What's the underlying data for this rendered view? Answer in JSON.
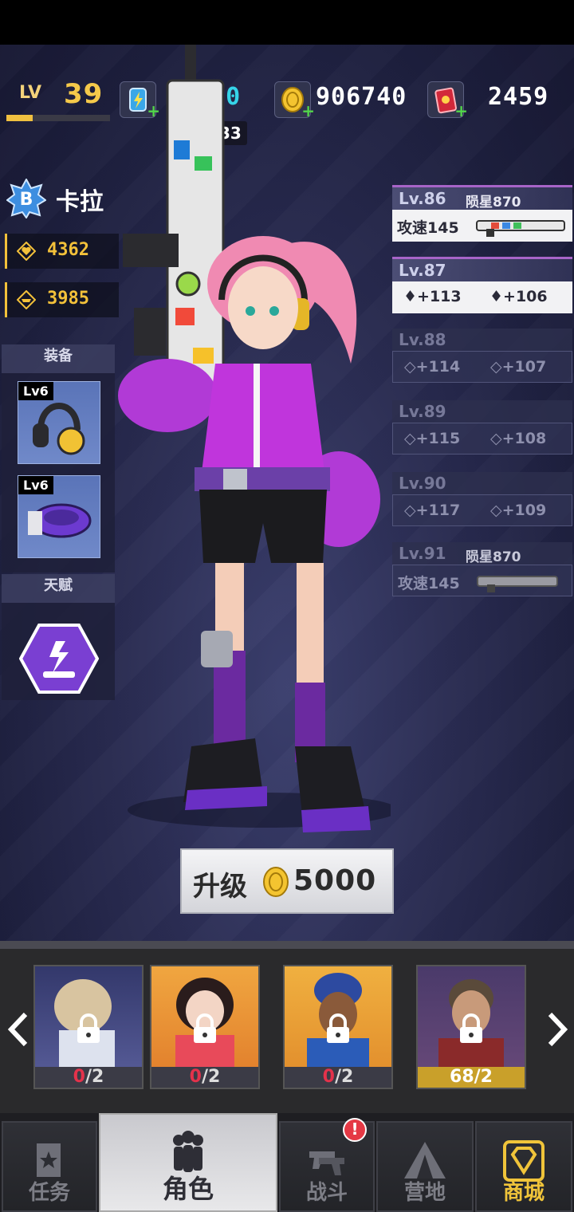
{
  "top_bar": {
    "level_label": "LV",
    "level_value": "39",
    "level_progress": 0.25,
    "energy": "6/60",
    "energy_timer": "00:33",
    "coins": "906740",
    "gems": "2459"
  },
  "character": {
    "rank": "B",
    "name": "卡拉",
    "hp": "4362",
    "defense": "3985"
  },
  "equipment": {
    "title": "装备",
    "slots": [
      {
        "level": "Lv6",
        "item": "headphones-icon"
      },
      {
        "level": "Lv6",
        "item": "collar-icon"
      }
    ]
  },
  "talent": {
    "title": "天赋"
  },
  "level_list": [
    {
      "level": "Lv.86",
      "note": "陨星870",
      "body": "攻速145",
      "type": "weapon",
      "state": "unlocked"
    },
    {
      "level": "Lv.87",
      "hp": "+113",
      "def": "+106",
      "type": "stats",
      "state": "current"
    },
    {
      "level": "Lv.88",
      "hp": "+114",
      "def": "+107",
      "type": "stats",
      "state": "locked"
    },
    {
      "level": "Lv.89",
      "hp": "+115",
      "def": "+108",
      "type": "stats",
      "state": "locked"
    },
    {
      "level": "Lv.90",
      "hp": "+117",
      "def": "+109",
      "type": "stats",
      "state": "locked"
    },
    {
      "level": "Lv.91",
      "note": "陨星870",
      "body": "攻速145",
      "type": "weapon",
      "state": "locked"
    }
  ],
  "upgrade": {
    "label": "升级",
    "cost": "5000"
  },
  "roster": [
    {
      "count_zero": "0",
      "count_rest": "/2",
      "highlight": false
    },
    {
      "count_zero": "0",
      "count_rest": "/2",
      "highlight": false
    },
    {
      "count_zero": "0",
      "count_rest": "/2",
      "highlight": false
    },
    {
      "count_zero": "",
      "count_rest": "68/2",
      "highlight": true
    }
  ],
  "nav": {
    "tabs": [
      {
        "label": "任务"
      },
      {
        "label": "角色"
      },
      {
        "label": "战斗",
        "badge": "!"
      },
      {
        "label": "营地"
      },
      {
        "label": "商城"
      }
    ]
  },
  "colors": {
    "gold": "#f3c13a",
    "energy": "#36d4e8",
    "accent_purple": "#a764c8"
  }
}
